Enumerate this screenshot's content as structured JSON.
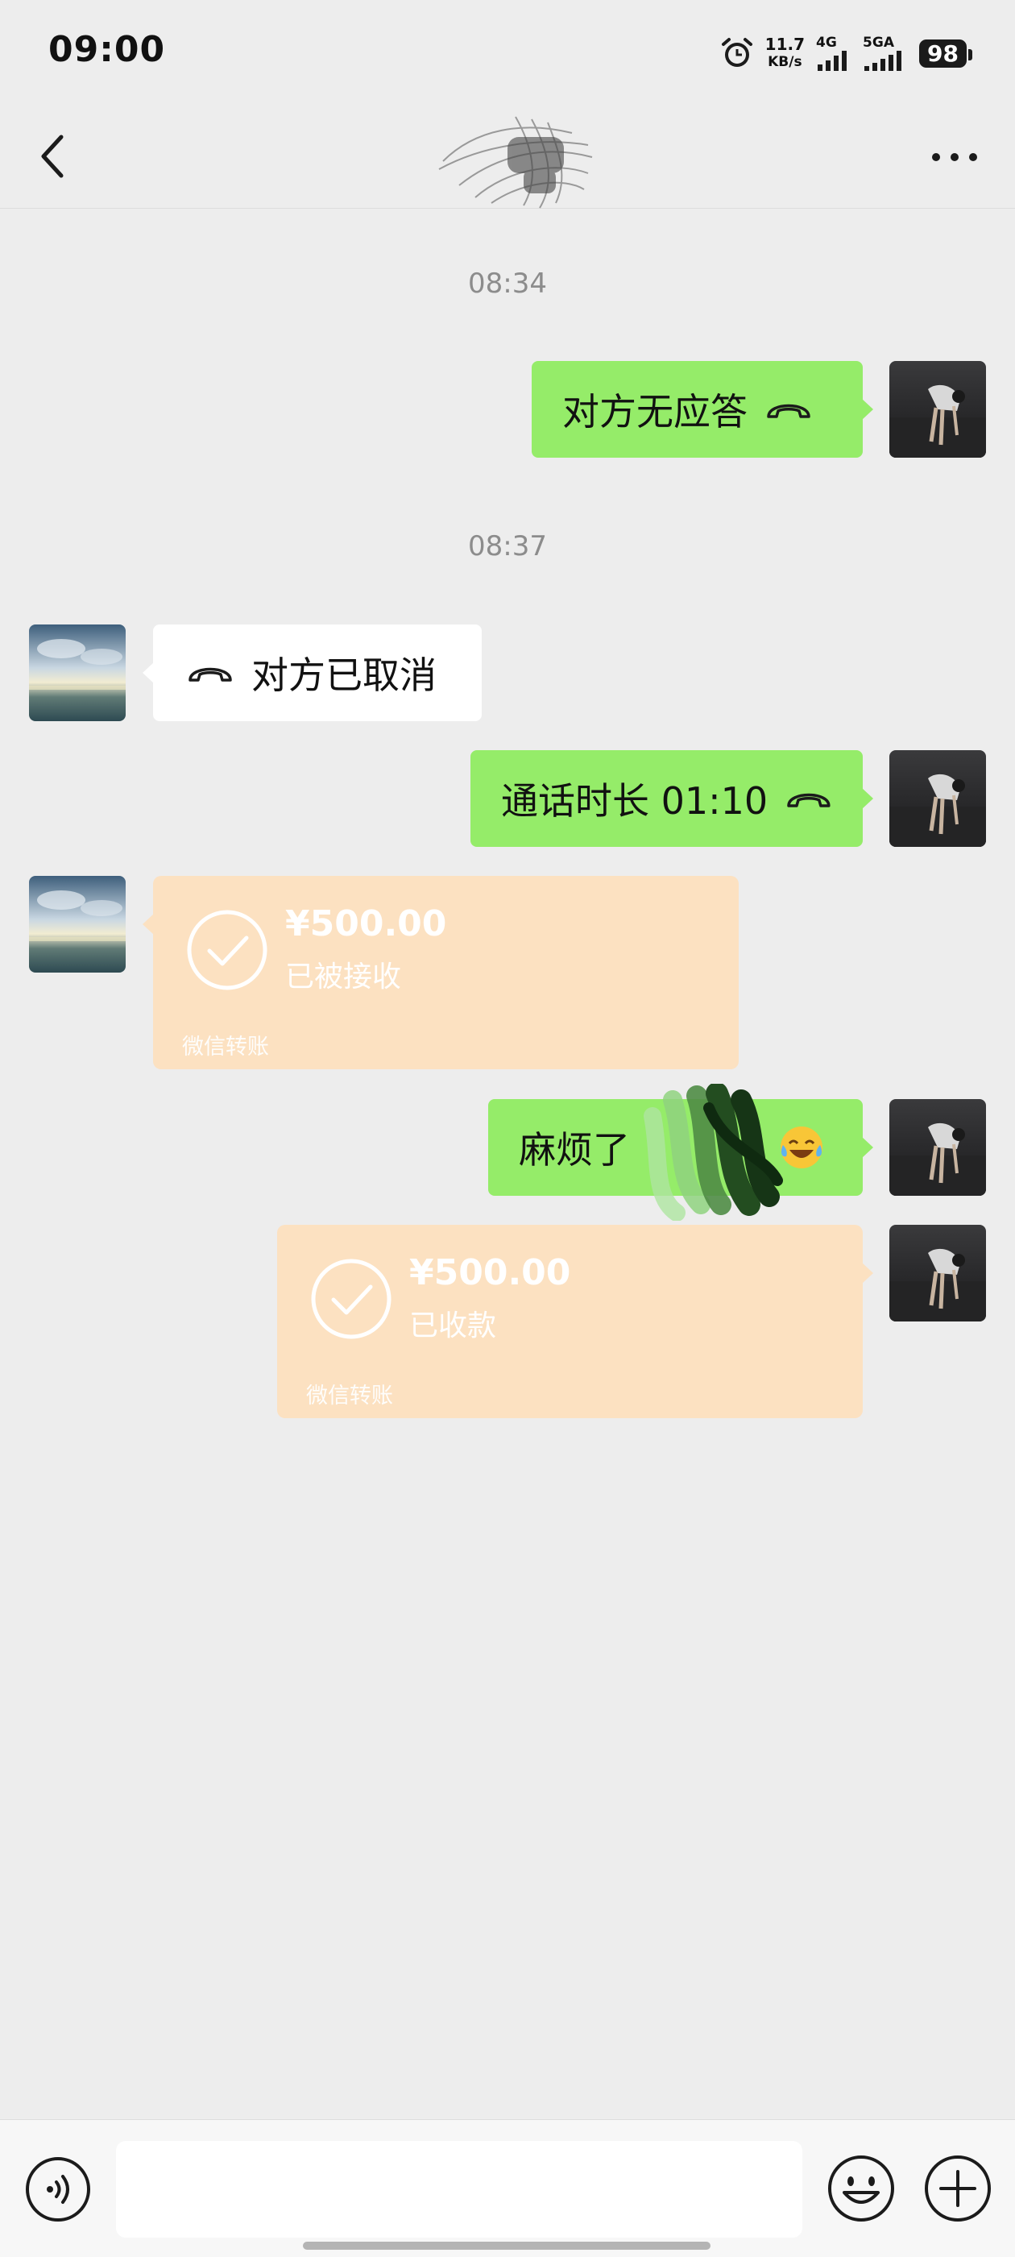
{
  "status_bar": {
    "time": "09:00",
    "net_speed": "11.7",
    "net_speed_unit": "KB/s",
    "sim1_label": "4G",
    "sim2_label": "5GA",
    "battery": "98"
  },
  "header": {
    "back_icon": "chevron-left-icon",
    "more_icon": "ellipsis-icon"
  },
  "chat": {
    "timestamp_1": "08:34",
    "msg_1_text": "对方无应答",
    "timestamp_2": "08:37",
    "msg_2_text": "对方已取消",
    "msg_3_text": "通话时长 01:10",
    "transfer_1": {
      "amount": "¥500.00",
      "status": "已被接收",
      "footer": "微信转账"
    },
    "msg_4_text": "麻烦了",
    "transfer_2": {
      "amount": "¥500.00",
      "status": "已收款",
      "footer": "微信转账"
    }
  },
  "input_bar": {
    "voice_icon": "voice-icon",
    "emoji_icon": "emoji-icon",
    "plus_icon": "plus-icon",
    "input_value": ""
  },
  "colors": {
    "outgoing_bubble": "#95ec69",
    "incoming_bubble": "#ffffff",
    "transfer_card": "#fce1c1",
    "background": "#ededed"
  }
}
